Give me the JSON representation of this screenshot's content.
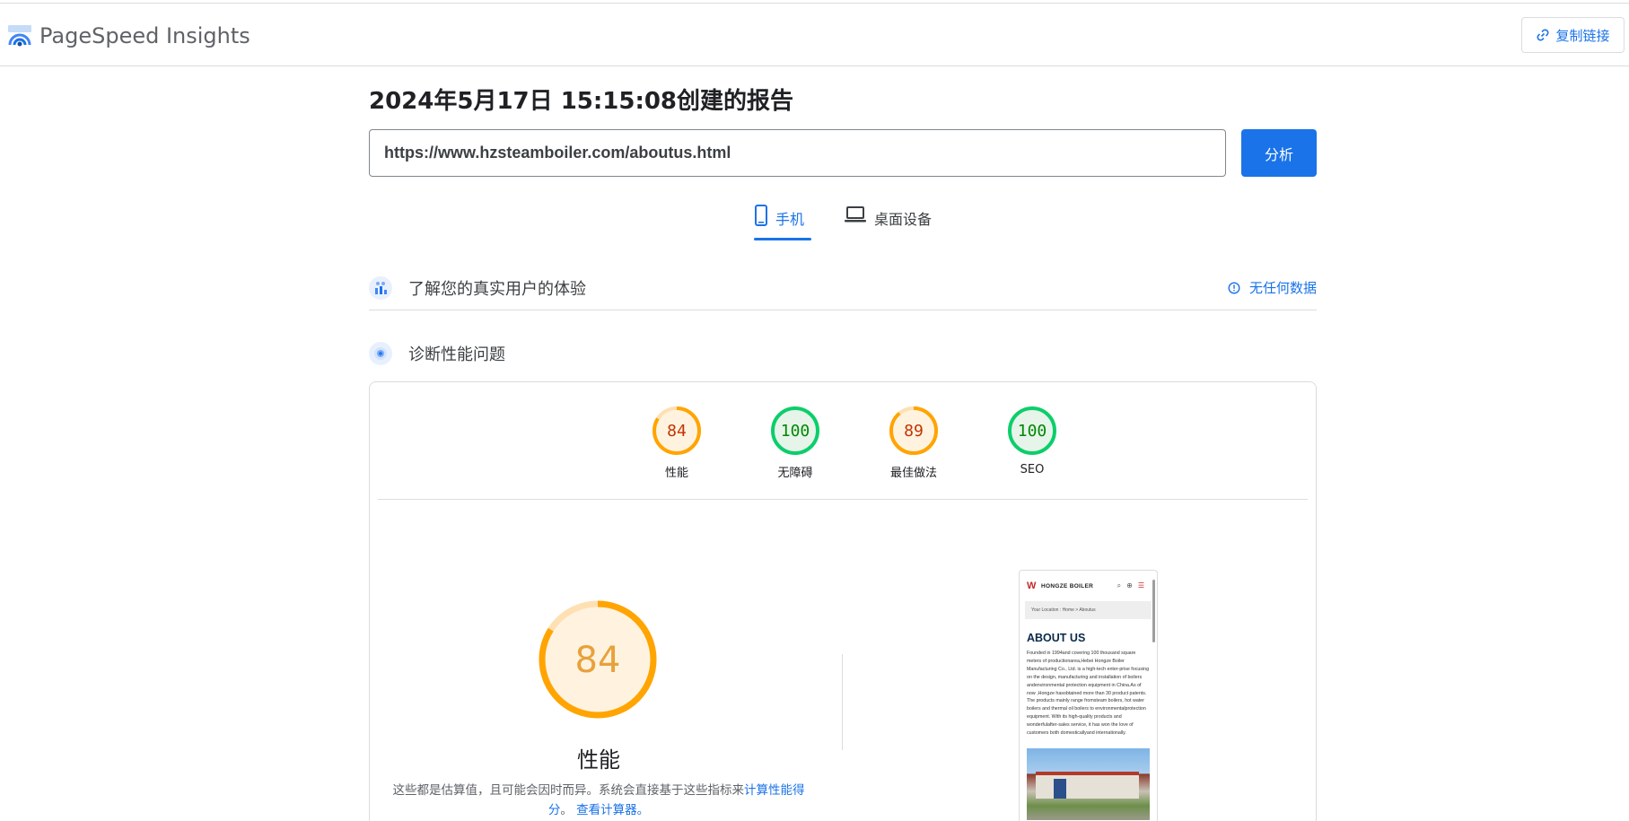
{
  "header": {
    "brand": "PageSpeed Insights",
    "copy_link_label": "复制链接"
  },
  "report": {
    "title": "2024年5月17日 15:15:08创建的报告",
    "url_value": "https://www.hzsteamboiler.com/aboutus.html",
    "analyze_label": "分析"
  },
  "tabs": [
    {
      "label": "手机",
      "icon": "phone-icon",
      "active": true
    },
    {
      "label": "桌面设备",
      "icon": "laptop-icon",
      "active": false
    }
  ],
  "crux": {
    "title": "了解您的真实用户的体验",
    "status": "无任何数据"
  },
  "diagnose": {
    "title": "诊断性能问题"
  },
  "scores": [
    {
      "label": "性能",
      "value": "84",
      "level": "average"
    },
    {
      "label": "无障碍",
      "value": "100",
      "level": "pass"
    },
    {
      "label": "最佳做法",
      "value": "89",
      "level": "average"
    },
    {
      "label": "SEO",
      "value": "100",
      "level": "pass"
    }
  ],
  "performance": {
    "score": "84",
    "label": "性能",
    "disclaimer_text": "这些都是估算值，且可能会因时而异。系统会直接基于这些指标来",
    "link_calc_score": "计算性能得分",
    "sep": "。",
    "link_calculator": "查看计算器。"
  },
  "screenshot": {
    "brand": "HONGZE BOILER",
    "breadcrumb": "Your Location : Home > Aboutus",
    "heading": "ABOUT US",
    "body": "Founded in 1994and covering 100 thousand square meters of productionarea,Hebei Hongze Boiler Manufacturing Co., Ltd. is a high-tech enter-prise focusing on the design, manufacturing and installation of boilers andenvironmental protection equipment in China.As of now ,Hongze hasobtained more than 30 product patents. The products mainly range fromsteam boilers, hot water boilers and thermal oil boilers to environmentalprotection equipment. With its high-quality products and wonderfulafter-sales service, it has won the love of customers both domesticallyand internationally."
  },
  "colors": {
    "accent": "#1a73e8",
    "average_stroke": "#ffa400",
    "average_fill": "#fff3e0",
    "average_text": "#c33300",
    "pass_stroke": "#0cce6b",
    "pass_fill": "#e6f4ea",
    "pass_text": "#008800"
  }
}
